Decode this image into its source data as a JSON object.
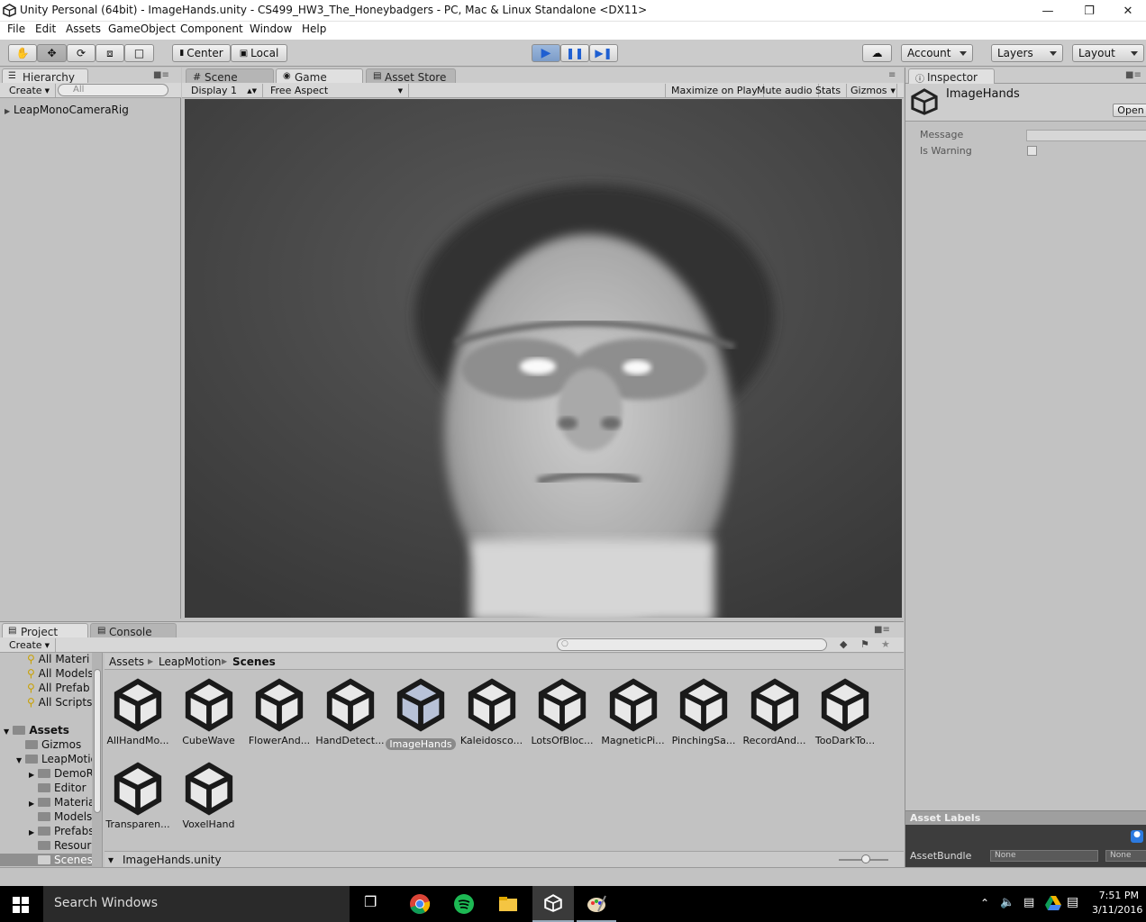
{
  "window": {
    "title": "Unity Personal (64bit) - ImageHands.unity - CS499_HW3_The_Honeybadgers - PC, Mac & Linux Standalone <DX11>"
  },
  "menu": [
    "File",
    "Edit",
    "Assets",
    "GameObject",
    "Component",
    "Window",
    "Help"
  ],
  "toolbar": {
    "pivot": "Center",
    "space": "Local",
    "account": "Account",
    "layers": "Layers",
    "layout": "Layout"
  },
  "hierarchy": {
    "tab": "Hierarchy",
    "create": "Create",
    "search_placeholder": "All",
    "items": [
      "LeapMonoCameraRig"
    ]
  },
  "view_tabs": {
    "scene": "Scene",
    "game": "Game",
    "asset_store": "Asset Store"
  },
  "game_bar": {
    "display": "Display 1",
    "aspect": "Free Aspect",
    "maximize": "Maximize on Play",
    "mute": "Mute audio",
    "stats": "Stats",
    "gizmos": "Gizmos"
  },
  "inspector": {
    "tab": "Inspector",
    "object": "ImageHands",
    "open": "Open",
    "fields": [
      {
        "label": "Message"
      },
      {
        "label": "Is Warning"
      }
    ],
    "asset_labels": "Asset Labels",
    "asset_bundle": "AssetBundle",
    "bundle_value": "None",
    "bundle_variant": "None"
  },
  "project": {
    "tab": "Project",
    "console_tab": "Console",
    "create": "Create",
    "favorites": [
      "All Materi",
      "All Models",
      "All Prefab",
      "All Scripts"
    ],
    "assets_root": "Assets",
    "tree": [
      "Gizmos",
      "LeapMotic",
      "DemoR",
      "Editor",
      "Materia",
      "Models",
      "Prefabs",
      "Resour",
      "Scenes"
    ],
    "breadcrumb": [
      "Assets",
      "LeapMotion",
      "Scenes"
    ],
    "files": [
      "AllHandMo...",
      "CubeWave",
      "FlowerAnd...",
      "HandDetect...",
      "ImageHands",
      "Kaleidosco...",
      "LotsOfBloc...",
      "MagneticPi...",
      "PinchingSa...",
      "RecordAnd...",
      "TooDarkTo...",
      "Transparen...",
      "VoxelHand"
    ],
    "selected_file": "ImageHands",
    "footer": "ImageHands.unity"
  },
  "taskbar": {
    "search": "Search Windows",
    "time": "7:51 PM",
    "date": "3/11/2016"
  }
}
